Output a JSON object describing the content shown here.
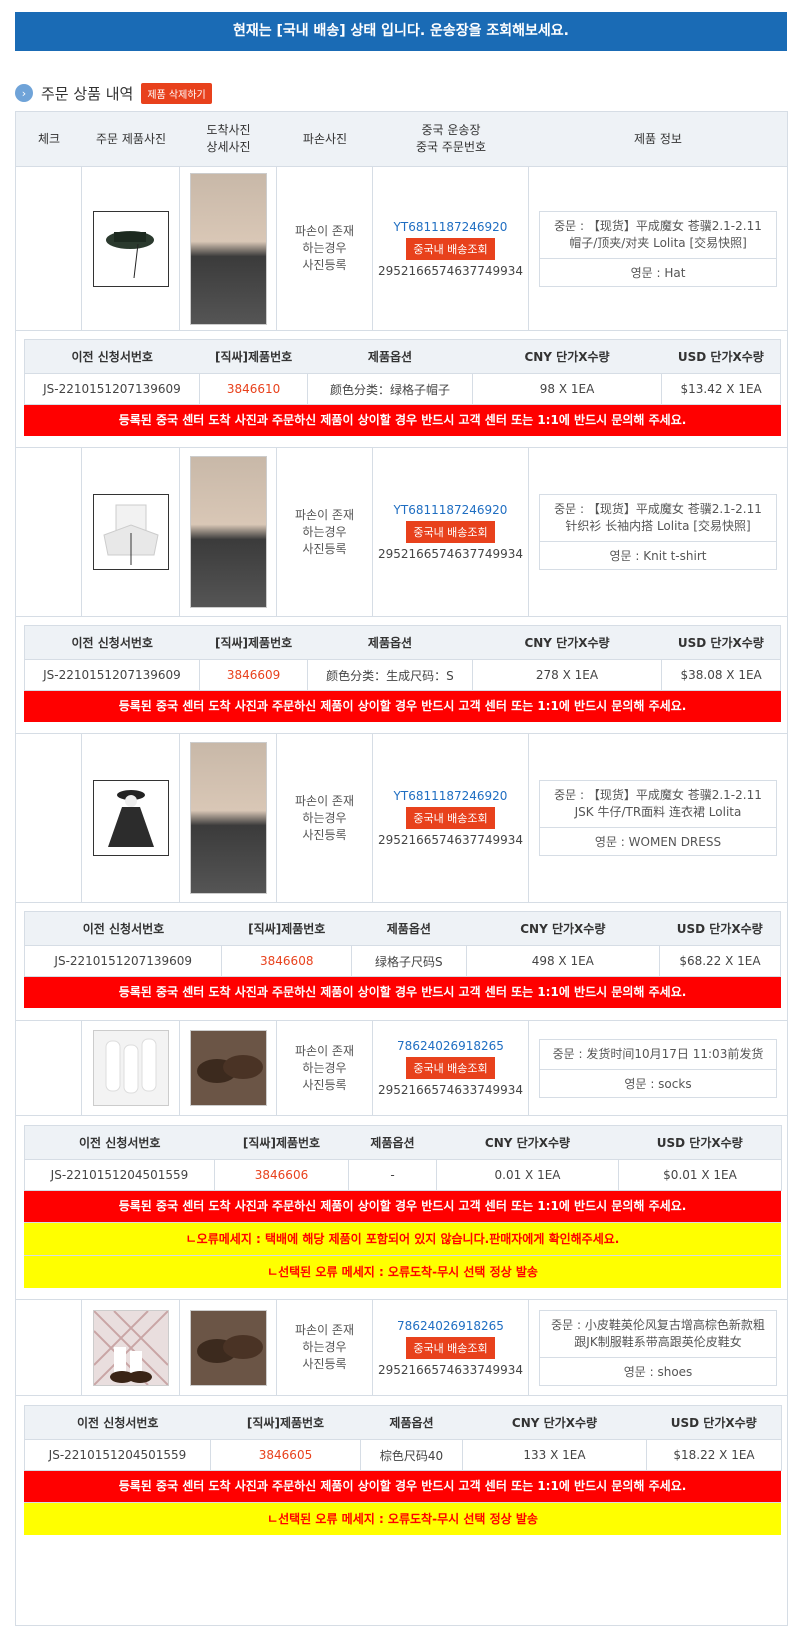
{
  "banner": "현재는 [국내 배송] 상태 입니다. 운송장을 조회해보세요.",
  "section": {
    "title": "주문 상품 내역",
    "delete_button": "제품 삭제하기"
  },
  "columns": {
    "check": "체크",
    "photo": "주문 제품사진",
    "arrival_1": "도착사진",
    "arrival_2": "상세사진",
    "damage": "파손사진",
    "tracking_1": "중국 운송장",
    "tracking_2": "중국 주문번호",
    "info": "제품 정보"
  },
  "sub_columns": {
    "prev": "이전 신청서번호",
    "code": "[직싸]제품번호",
    "option": "제품옵션",
    "cny": "CNY 단가X수량",
    "usd": "USD 단가X수량"
  },
  "damage_text_1": "파손이 존재",
  "damage_text_2": "하는경우",
  "damage_text_3": "사진등록",
  "track_button": "중국내 배송조회",
  "warning_text": "등록된 중국 센터 도착 사진과 주문하신 제품이 상이할 경우 반드시 고객 센터 또는 1:1에 반드시 문의해 주세요.",
  "items": [
    {
      "tracking": "YT6811187246920",
      "order_no": "2952166574637749934",
      "info_cn": "중문 : 【现货】平成魔女 苍骥2.1-2.11 帽子/顶夹/对夹 Lolita [交易快照]",
      "info_en": "영문 : Hat",
      "prev": "JS-2210151207139609",
      "code": "3846610",
      "option": "颜色分类：绿格子帽子",
      "cny": "98 X 1EA",
      "usd": "$13.42 X 1EA"
    },
    {
      "tracking": "YT6811187246920",
      "order_no": "2952166574637749934",
      "info_cn": "중문 : 【现货】平成魔女 苍骥2.1-2.11 针织衫 长袖内搭 Lolita [交易快照]",
      "info_en": "영문 : Knit t-shirt",
      "prev": "JS-2210151207139609",
      "code": "3846609",
      "option": "颜色分类：生成尺码：S",
      "cny": "278 X 1EA",
      "usd": "$38.08 X 1EA"
    },
    {
      "tracking": "YT6811187246920",
      "order_no": "2952166574637749934",
      "info_cn": "중문 : 【现货】平成魔女 苍骥2.1-2.11 JSK 牛仔/TR面料 连衣裙 Lolita",
      "info_en": "영문 : WOMEN DRESS",
      "prev": "JS-2210151207139609",
      "code": "3846608",
      "option": "绿格子尺码S",
      "cny": "498 X 1EA",
      "usd": "$68.22 X 1EA"
    },
    {
      "tracking": "78624026918265",
      "order_no": "2952166574633749934",
      "info_cn": "중문 : 发货时间10月17日 11:03前发货",
      "info_en": "영문 : socks",
      "prev": "JS-2210151204501559",
      "code": "3846606",
      "option": "-",
      "cny": "0.01 X 1EA",
      "usd": "$0.01 X 1EA",
      "error_msg": "ㄴ오류메세지 : 택배에 해당 제품이 포함되어 있지 않습니다.판매자에게 확인해주세요.",
      "selected_error": "ㄴ선택된 오류 메세지 : 오류도착-무시 선택 정상 발송"
    },
    {
      "tracking": "78624026918265",
      "order_no": "2952166574633749934",
      "info_cn": "중문 : 小皮鞋英伦风复古增高棕色新款粗跟JK制服鞋系带高跟英伦皮鞋女",
      "info_en": "영문 : shoes",
      "prev": "JS-2210151204501559",
      "code": "3846605",
      "option": "棕色尺码40",
      "cny": "133 X 1EA",
      "usd": "$18.22 X 1EA",
      "selected_error": "ㄴ선택된 오류 메세지 : 오류도착-무시 선택 정상 발송"
    }
  ]
}
